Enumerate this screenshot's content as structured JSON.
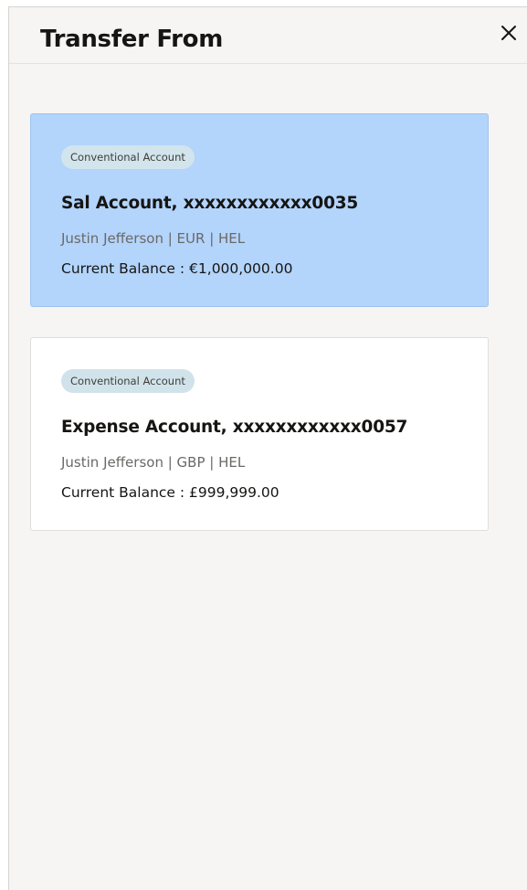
{
  "dialog": {
    "title": "Transfer From",
    "close_icon": "close-icon",
    "close_glyph": "×"
  },
  "accounts": [
    {
      "type_badge": "Conventional Account",
      "name": "Sal Account, xxxxxxxxxxxx0035",
      "owner_line": "Justin Jefferson | EUR | HEL",
      "balance_line": "Current Balance : €1,000,000.00",
      "selected": true
    },
    {
      "type_badge": "Conventional Account",
      "name": "Expense Account, xxxxxxxxxxxx0057",
      "owner_line": "Justin Jefferson | GBP | HEL",
      "balance_line": "Current Balance : £999,999.00",
      "selected": false
    }
  ],
  "colors": {
    "panel_background": "#f6f5f3",
    "selected_card": "#b3d4fb",
    "card": "#ffffff",
    "badge": "#d2e4ec",
    "primary_text": "#161513",
    "secondary_text": "#6b6966"
  }
}
